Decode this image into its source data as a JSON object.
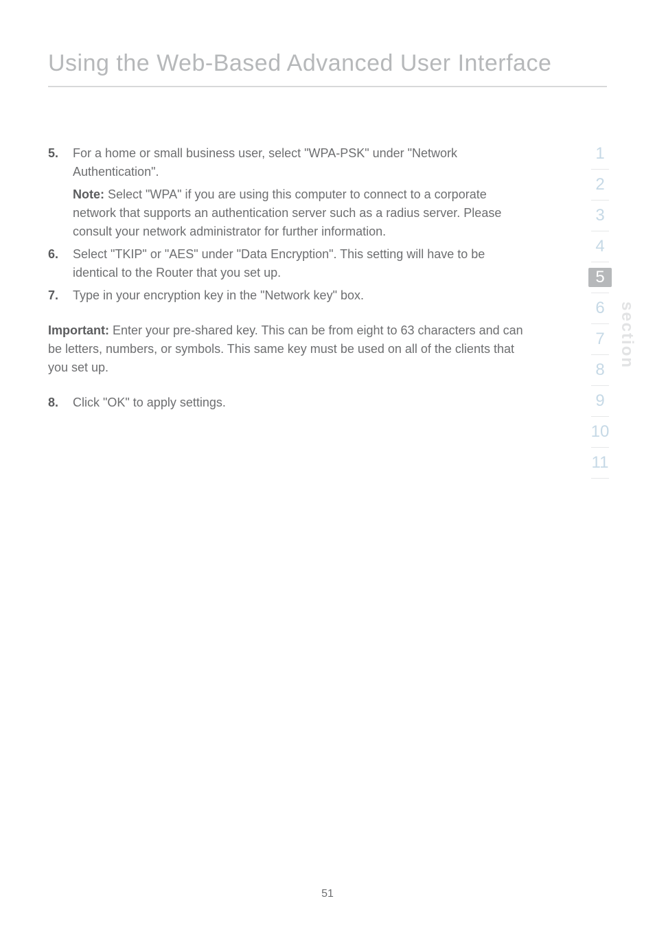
{
  "title": "Using the Web-Based Advanced User Interface",
  "steps": [
    {
      "marker": "5.",
      "text": "For a home or small business user, select \"WPA-PSK\" under \"Network Authentication\".",
      "note_label": "Note:",
      "note_text": " Select \"WPA\" if you are using this computer to connect to a corporate network that supports an authentication server such as a radius server. Please consult your network administrator for further information."
    },
    {
      "marker": "6.",
      "text": "Select \"TKIP\" or \"AES\" under \"Data Encryption\". This setting will have to be identical to the Router that you set up."
    },
    {
      "marker": "7.",
      "text": "Type in your encryption key in the \"Network key\" box."
    }
  ],
  "important_label": "Important:",
  "important_text": " Enter your pre-shared key. This can be from eight to 63 characters and can be letters, numbers, or symbols. This same key must be used on all of the clients that you set up.",
  "final_step": {
    "marker": "8.",
    "text": "Click \"OK\" to apply settings."
  },
  "section_label": "section",
  "nav_numbers": [
    "1",
    "2",
    "3",
    "4",
    "5",
    "6",
    "7",
    "8",
    "9",
    "10",
    "11"
  ],
  "active_section_index": 4,
  "page_number": "51"
}
